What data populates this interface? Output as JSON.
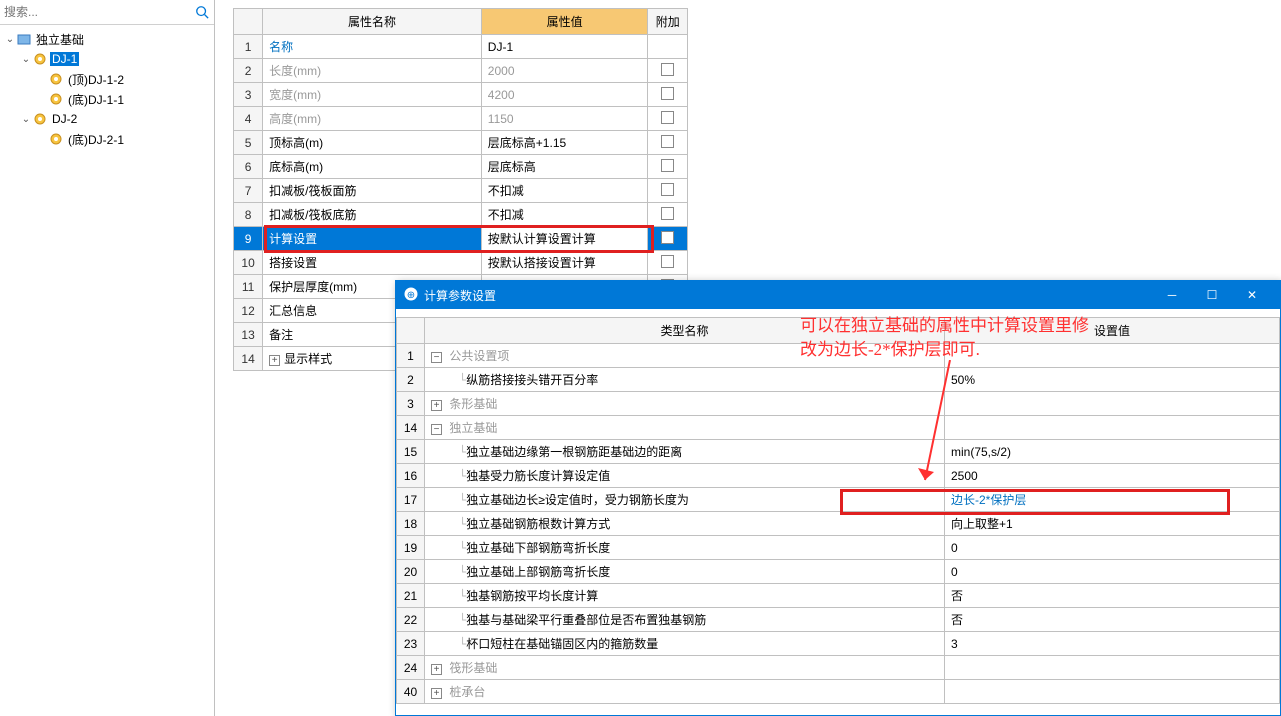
{
  "search": {
    "placeholder": "搜索..."
  },
  "tree": {
    "root": "独立基础",
    "dj1": "DJ-1",
    "dj1_top": "(顶)DJ-1-2",
    "dj1_bot": "(底)DJ-1-1",
    "dj2": "DJ-2",
    "dj2_bot": "(底)DJ-2-1"
  },
  "prop_headers": {
    "name": "属性名称",
    "value": "属性值",
    "extra": "附加"
  },
  "props": [
    {
      "n": "1",
      "name": "名称",
      "val": "DJ-1",
      "blue": true
    },
    {
      "n": "2",
      "name": "长度(mm)",
      "val": "2000",
      "gray": true
    },
    {
      "n": "3",
      "name": "宽度(mm)",
      "val": "4200",
      "gray": true
    },
    {
      "n": "4",
      "name": "高度(mm)",
      "val": "1150",
      "gray": true
    },
    {
      "n": "5",
      "name": "顶标高(m)",
      "val": "层底标高+1.15"
    },
    {
      "n": "6",
      "name": "底标高(m)",
      "val": "层底标高"
    },
    {
      "n": "7",
      "name": "扣减板/筏板面筋",
      "val": "不扣减"
    },
    {
      "n": "8",
      "name": "扣减板/筏板底筋",
      "val": "不扣减"
    },
    {
      "n": "9",
      "name": "计算设置",
      "val": "按默认计算设置计算",
      "selected": true
    },
    {
      "n": "10",
      "name": "搭接设置",
      "val": "按默认搭接设置计算"
    },
    {
      "n": "11",
      "name": "保护层厚度(mm)",
      "val": ""
    },
    {
      "n": "12",
      "name": "汇总信息",
      "val": ""
    },
    {
      "n": "13",
      "name": "备注",
      "val": ""
    },
    {
      "n": "14",
      "name": "显示样式",
      "val": "",
      "expand": "+"
    }
  ],
  "dialog": {
    "title": "计算参数设置",
    "headers": {
      "type": "类型名称",
      "value": "设置值"
    },
    "rows": [
      {
        "n": "1",
        "name": "公共设置项",
        "section": true,
        "exp": "−"
      },
      {
        "n": "2",
        "name": "纵筋搭接接头错开百分率",
        "val": "50%",
        "indent": 2
      },
      {
        "n": "3",
        "name": "条形基础",
        "section": true,
        "exp": "+"
      },
      {
        "n": "14",
        "name": "独立基础",
        "section": true,
        "exp": "−"
      },
      {
        "n": "15",
        "name": "独立基础边缘第一根钢筋距基础边的距离",
        "val": "min(75,s/2)",
        "indent": 2
      },
      {
        "n": "16",
        "name": "独基受力筋长度计算设定值",
        "val": "2500",
        "indent": 2
      },
      {
        "n": "17",
        "name": "独立基础边长≥设定值时，受力钢筋长度为",
        "val": "边长-2*保护层",
        "indent": 2,
        "hl": true
      },
      {
        "n": "18",
        "name": "独立基础钢筋根数计算方式",
        "val": "向上取整+1",
        "indent": 2
      },
      {
        "n": "19",
        "name": "独立基础下部钢筋弯折长度",
        "val": "0",
        "indent": 2
      },
      {
        "n": "20",
        "name": "独立基础上部钢筋弯折长度",
        "val": "0",
        "indent": 2
      },
      {
        "n": "21",
        "name": "独基钢筋按平均长度计算",
        "val": "否",
        "indent": 2
      },
      {
        "n": "22",
        "name": "独基与基础梁平行重叠部位是否布置独基钢筋",
        "val": "否",
        "indent": 2
      },
      {
        "n": "23",
        "name": "杯口短柱在基础锚固区内的箍筋数量",
        "val": "3",
        "indent": 2
      },
      {
        "n": "24",
        "name": "筏形基础",
        "section": true,
        "exp": "+"
      },
      {
        "n": "40",
        "name": "桩承台",
        "section": true,
        "exp": "+"
      }
    ]
  },
  "annotation": {
    "line1": "可以在独立基础的属性中计算设置里修",
    "line2": "改为边长-2*保护层即可."
  }
}
